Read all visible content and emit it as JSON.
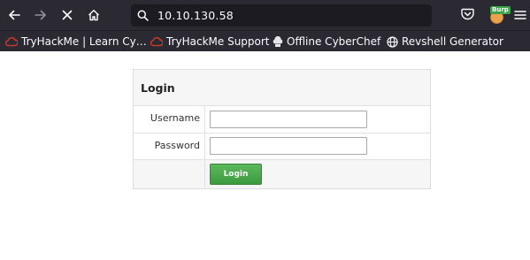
{
  "browser": {
    "url": "10.10.130.58",
    "extension_badge": "Burp",
    "bookmarks": [
      {
        "label": "TryHackMe | Learn Cy…",
        "icon": "tryhackme-icon"
      },
      {
        "label": "TryHackMe Support",
        "icon": "tryhackme-icon"
      },
      {
        "label": "Offline CyberChef",
        "icon": "chef-hat-icon"
      },
      {
        "label": "Revshell Generator",
        "icon": "globe-icon"
      }
    ]
  },
  "login": {
    "title": "Login",
    "username_label": "Username",
    "username_value": "",
    "password_label": "Password",
    "password_value": "",
    "submit_label": "Login"
  },
  "colors": {
    "toolbar_bg": "#2b2a33",
    "urlbar_bg": "#1c1b22",
    "button_green": "#4cae4c",
    "tryhackme_red": "#c0392b"
  }
}
